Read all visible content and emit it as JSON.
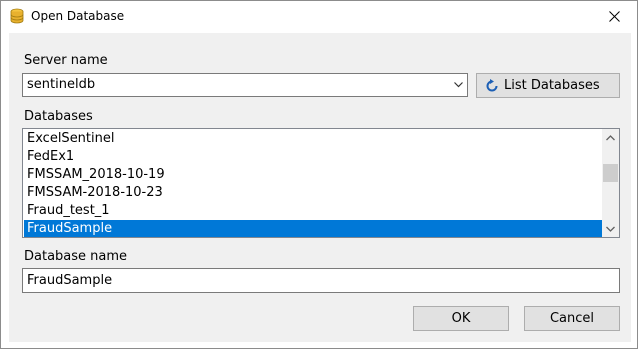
{
  "window": {
    "title": "Open Database",
    "icon": "database-icon",
    "close_icon": "close-icon"
  },
  "server": {
    "label": "Server name",
    "value": "sentineldb",
    "list_button_label": "List Databases",
    "list_button_icon": "refresh-icon"
  },
  "databases": {
    "label": "Databases",
    "items": [
      "ExcelSentinel",
      "FedEx1",
      "FMSSAM_2018-10-19",
      "FMSSAM-2018-10-23",
      "Fraud_test_1",
      "FraudSample"
    ],
    "selected": "FraudSample"
  },
  "database_name": {
    "label": "Database name",
    "value": "FraudSample"
  },
  "buttons": {
    "ok": "OK",
    "cancel": "Cancel"
  },
  "colors": {
    "selection": "#0078d7",
    "dialog_bg": "#f0f0f0",
    "button_bg": "#e1e1e1"
  }
}
